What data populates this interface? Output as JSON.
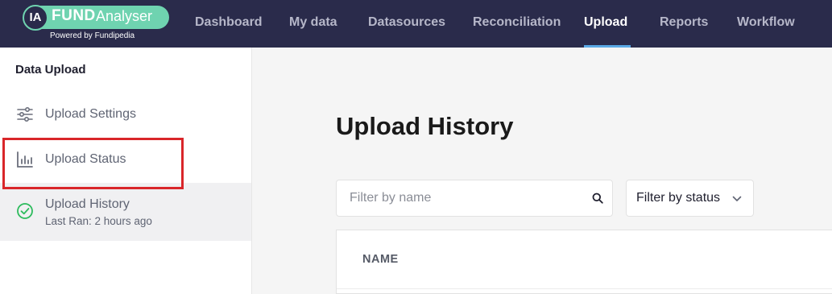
{
  "brand": {
    "badge": "IA",
    "name_bold": "FUND",
    "name_light": "Analyser",
    "powered_by": "Powered by Fundipedia"
  },
  "nav": {
    "items": [
      {
        "label": "Dashboard"
      },
      {
        "label": "My data"
      },
      {
        "label": "Datasources"
      },
      {
        "label": "Reconciliation"
      },
      {
        "label": "Upload",
        "active": true
      },
      {
        "label": "Reports"
      },
      {
        "label": "Workflow"
      }
    ]
  },
  "sidebar": {
    "title": "Data Upload",
    "items": [
      {
        "label": "Upload Settings",
        "icon": "sliders-icon"
      },
      {
        "label": "Upload Status",
        "icon": "bar-chart-icon"
      },
      {
        "label": "Upload History",
        "sub": "Last Ran: 2 hours ago",
        "icon": "check-circle-icon",
        "selected": true
      }
    ]
  },
  "main": {
    "title": "Upload History",
    "filter_name_placeholder": "Filter by name",
    "filter_status_label": "Filter by status",
    "table": {
      "columns": [
        "NAME"
      ]
    }
  },
  "colors": {
    "topbar": "#2a2b4b",
    "brand_accent": "#6fd3b0",
    "active_underline": "#5aa9e6",
    "success": "#2dbb5d",
    "highlight": "#d9262a"
  }
}
